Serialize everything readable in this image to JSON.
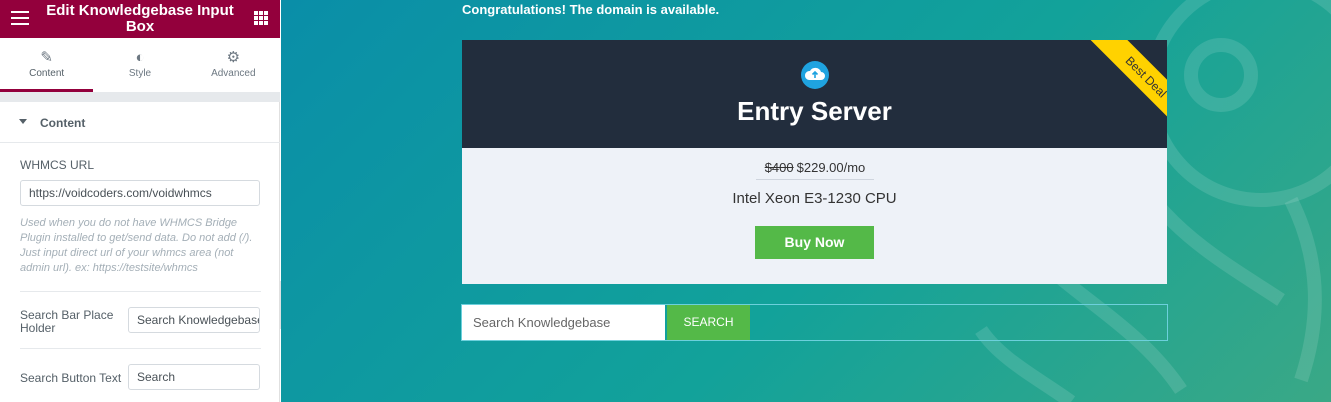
{
  "panel": {
    "title": "Edit Knowledgebase Input Box",
    "tabs": [
      {
        "label": "Content",
        "icon": "pencil-icon"
      },
      {
        "label": "Style",
        "icon": "half-circle-icon"
      },
      {
        "label": "Advanced",
        "icon": "gear-icon"
      }
    ],
    "section": "Content",
    "whmcs_url": {
      "label": "WHMCS URL",
      "value": "https://voidcoders.com/voidwhmcs",
      "note": "Used when you do not have WHMCS Bridge Plugin installed to get/send data. Do not add (/). Just input direct url of your whmcs area (not admin url). ex: https://testsite/whmcs"
    },
    "placeholder_field": {
      "label": "Search Bar Place Holder",
      "value": "Search Knowledgebase"
    },
    "button_text_field": {
      "label": "Search Button Text",
      "value": "Search"
    }
  },
  "preview": {
    "congrats": "Congratulations! The domain is available.",
    "card": {
      "ribbon": "Best Deal",
      "title": "Entry Server",
      "old_price": "$400",
      "price": "$229.00/mo",
      "cpu": "Intel Xeon E3-1230 CPU",
      "buy_label": "Buy Now"
    },
    "search": {
      "placeholder": "Search Knowledgebase",
      "button": "SEARCH"
    }
  },
  "colors": {
    "panel_accent": "#93003c",
    "card_dark": "#222d3d",
    "ribbon": "#ffd200",
    "button_green": "#54b948",
    "preview_bg": "#12a29a"
  }
}
